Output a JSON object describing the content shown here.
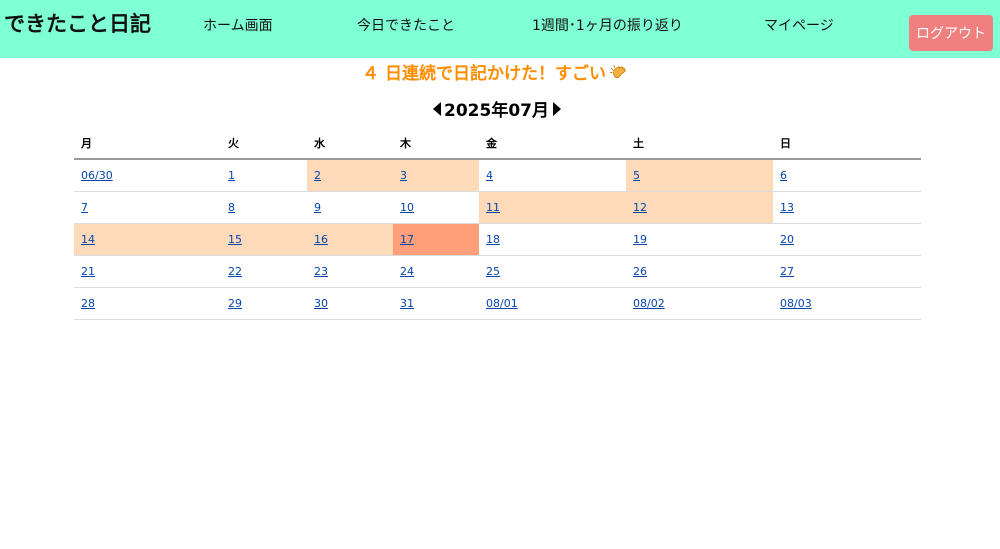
{
  "header": {
    "brand": "できたこと日記",
    "nav": {
      "home": "ホーム画面",
      "today": "今日できたこと",
      "review": "1週間･1ヶ月の振り返り",
      "mypage": "マイページ"
    },
    "logout_label": "ログアウト",
    "background_color": "#7fffd4",
    "logout_color": "#f08080"
  },
  "streak": {
    "text": "４ 日連続で日記かけた！すごい",
    "icon": "clapping-hands-icon",
    "color": "#ff8c00"
  },
  "calendar": {
    "month_label": "2025年07月",
    "weekdays": [
      "月",
      "火",
      "水",
      "木",
      "金",
      "土",
      "日"
    ],
    "written_color": "#ffdab9",
    "today_color": "#ffa07a",
    "weeks": [
      [
        {
          "label": "06/30",
          "state": ""
        },
        {
          "label": "1",
          "state": ""
        },
        {
          "label": "2",
          "state": "written"
        },
        {
          "label": "3",
          "state": "written"
        },
        {
          "label": "4",
          "state": ""
        },
        {
          "label": "5",
          "state": "written"
        },
        {
          "label": "6",
          "state": ""
        }
      ],
      [
        {
          "label": "7",
          "state": ""
        },
        {
          "label": "8",
          "state": ""
        },
        {
          "label": "9",
          "state": ""
        },
        {
          "label": "10",
          "state": ""
        },
        {
          "label": "11",
          "state": "written"
        },
        {
          "label": "12",
          "state": "written"
        },
        {
          "label": "13",
          "state": ""
        }
      ],
      [
        {
          "label": "14",
          "state": "written"
        },
        {
          "label": "15",
          "state": "written"
        },
        {
          "label": "16",
          "state": "written"
        },
        {
          "label": "17",
          "state": "today"
        },
        {
          "label": "18",
          "state": ""
        },
        {
          "label": "19",
          "state": ""
        },
        {
          "label": "20",
          "state": ""
        }
      ],
      [
        {
          "label": "21",
          "state": ""
        },
        {
          "label": "22",
          "state": ""
        },
        {
          "label": "23",
          "state": ""
        },
        {
          "label": "24",
          "state": ""
        },
        {
          "label": "25",
          "state": ""
        },
        {
          "label": "26",
          "state": ""
        },
        {
          "label": "27",
          "state": ""
        }
      ],
      [
        {
          "label": "28",
          "state": ""
        },
        {
          "label": "29",
          "state": ""
        },
        {
          "label": "30",
          "state": ""
        },
        {
          "label": "31",
          "state": ""
        },
        {
          "label": "08/01",
          "state": ""
        },
        {
          "label": "08/02",
          "state": ""
        },
        {
          "label": "08/03",
          "state": ""
        }
      ]
    ]
  }
}
